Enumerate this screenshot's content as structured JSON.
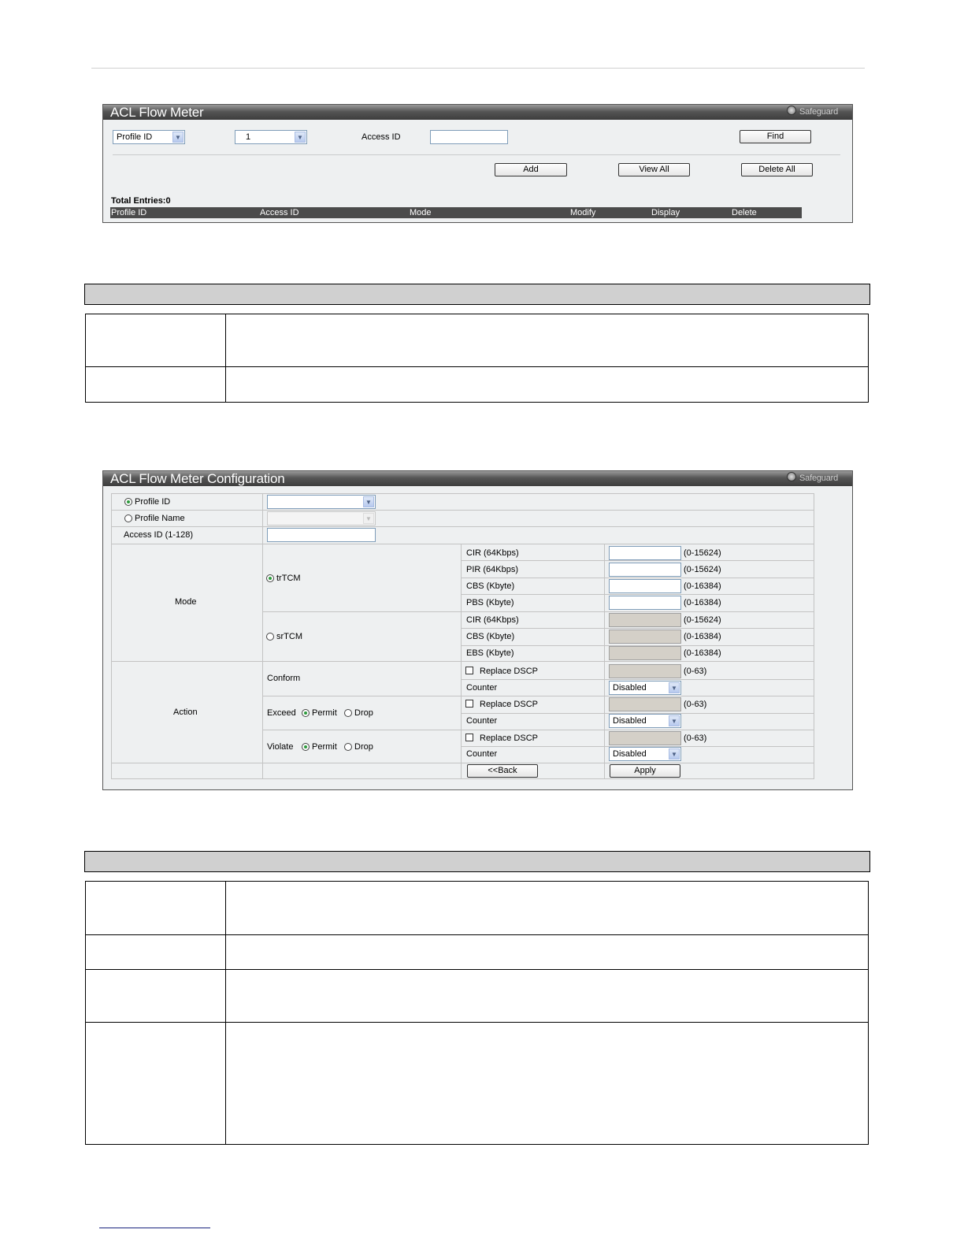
{
  "panel1": {
    "title": "ACL Flow Meter",
    "safeguard": "Safeguard",
    "profile_select": "Profile ID",
    "id_select": "1",
    "access_id_label": "Access ID",
    "access_id_value": "",
    "find_button": "Find",
    "add_button": "Add",
    "view_all_button": "View All",
    "delete_all_button": "Delete All",
    "total_entries": "Total Entries:0",
    "columns": [
      "Profile ID",
      "Access ID",
      "Mode",
      "Modify",
      "Display",
      "Delete"
    ]
  },
  "panel2": {
    "title": "ACL Flow Meter Configuration",
    "safeguard": "Safeguard",
    "profile_id_label": "Profile ID",
    "profile_name_label": "Profile Name",
    "access_id_label": "Access ID (1-128)",
    "mode_label": "Mode",
    "trtcm_label": "trTCM",
    "srtcm_label": "srTCM",
    "trtcm_rows": [
      {
        "label": "CIR (64Kbps)",
        "range": "(0-15624)"
      },
      {
        "label": "PIR (64Kbps)",
        "range": "(0-15624)"
      },
      {
        "label": "CBS (Kbyte)",
        "range": "(0-16384)"
      },
      {
        "label": "PBS (Kbyte)",
        "range": "(0-16384)"
      }
    ],
    "srtcm_rows": [
      {
        "label": "CIR (64Kbps)",
        "range": "(0-15624)"
      },
      {
        "label": "CBS (Kbyte)",
        "range": "(0-16384)"
      },
      {
        "label": "EBS (Kbyte)",
        "range": "(0-16384)"
      }
    ],
    "action_label": "Action",
    "conform_label": "Conform",
    "exceed_label": "Exceed",
    "violate_label": "Violate",
    "permit_label": "Permit",
    "drop_label": "Drop",
    "replace_dscp_label": "Replace DSCP",
    "dscp_range": "(0-63)",
    "counter_label": "Counter",
    "counter_value": "Disabled",
    "back_button": "<<Back",
    "apply_button": "Apply"
  }
}
